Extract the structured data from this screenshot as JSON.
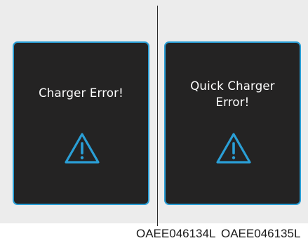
{
  "screens": [
    {
      "message": "Charger Error!",
      "icon": "warning-triangle-icon"
    },
    {
      "message": "Quick Charger\nError!",
      "icon": "warning-triangle-icon"
    }
  ],
  "codes": [
    "OAEE046134L",
    "OAEE046135L"
  ],
  "colors": {
    "accent": "#2a9fd6",
    "screen": "#242323",
    "background": "#ececec"
  }
}
